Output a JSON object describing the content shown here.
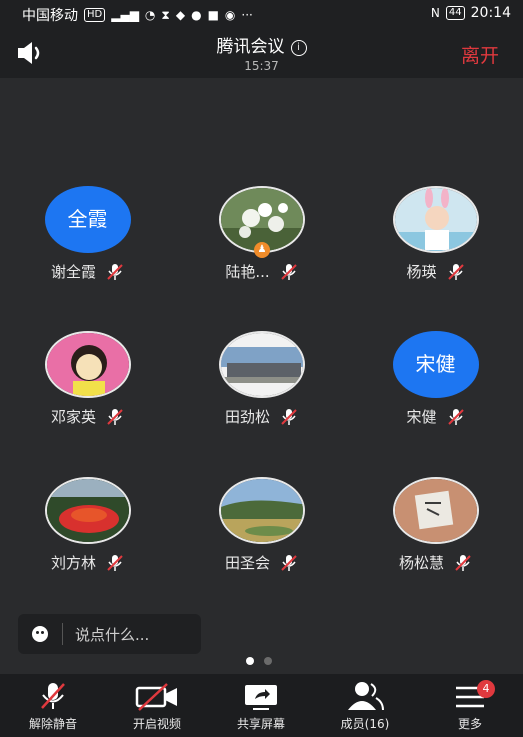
{
  "status_bar": {
    "carrier": "中国移动",
    "hd": "HD",
    "net": "4G",
    "battery": "44",
    "clock": "20:14"
  },
  "header": {
    "title": "腾讯会议",
    "elapsed": "15:37",
    "leave_label": "离开"
  },
  "participants": [
    {
      "name": "谢全霞",
      "avatar_text": "全霞"
    },
    {
      "name": "陆艳...",
      "avatar_text": ""
    },
    {
      "name": "杨瑛",
      "avatar_text": ""
    },
    {
      "name": "邓家英",
      "avatar_text": ""
    },
    {
      "name": "田劲松",
      "avatar_text": ""
    },
    {
      "name": "宋健",
      "avatar_text": "宋健"
    },
    {
      "name": "刘方林",
      "avatar_text": ""
    },
    {
      "name": "田圣会",
      "avatar_text": ""
    },
    {
      "name": "杨松慧",
      "avatar_text": ""
    }
  ],
  "chat": {
    "placeholder": "说点什么..."
  },
  "toolbar": {
    "unmute": "解除静音",
    "video": "开启视频",
    "share": "共享屏幕",
    "members": "成员(16)",
    "more": "更多",
    "more_badge": "4"
  },
  "colors": {
    "accent_blue": "#1d76f2",
    "leave_red": "#e0393e",
    "badge_orange": "#f08c2a"
  }
}
